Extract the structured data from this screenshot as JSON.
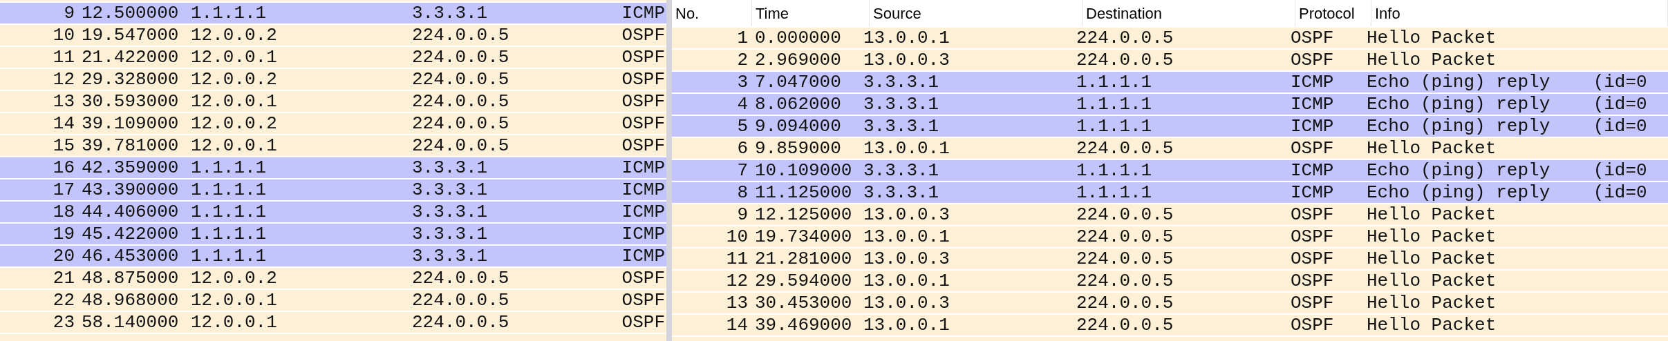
{
  "left_packet_list": {
    "rows": [
      {
        "no": "9",
        "time": "12.500000",
        "source": "1.1.1.1",
        "destination": "3.3.3.1",
        "protocol": "ICMP",
        "color": "#c4c4fc"
      },
      {
        "no": "10",
        "time": "19.547000",
        "source": "12.0.0.2",
        "destination": "224.0.0.5",
        "protocol": "OSPF",
        "color": "#fdf0d6"
      },
      {
        "no": "11",
        "time": "21.422000",
        "source": "12.0.0.1",
        "destination": "224.0.0.5",
        "protocol": "OSPF",
        "color": "#fdf0d6"
      },
      {
        "no": "12",
        "time": "29.328000",
        "source": "12.0.0.2",
        "destination": "224.0.0.5",
        "protocol": "OSPF",
        "color": "#fdf0d6"
      },
      {
        "no": "13",
        "time": "30.593000",
        "source": "12.0.0.1",
        "destination": "224.0.0.5",
        "protocol": "OSPF",
        "color": "#fdf0d6"
      },
      {
        "no": "14",
        "time": "39.109000",
        "source": "12.0.0.2",
        "destination": "224.0.0.5",
        "protocol": "OSPF",
        "color": "#fdf0d6"
      },
      {
        "no": "15",
        "time": "39.781000",
        "source": "12.0.0.1",
        "destination": "224.0.0.5",
        "protocol": "OSPF",
        "color": "#fdf0d6"
      },
      {
        "no": "16",
        "time": "42.359000",
        "source": "1.1.1.1",
        "destination": "3.3.3.1",
        "protocol": "ICMP",
        "color": "#c4c4fc"
      },
      {
        "no": "17",
        "time": "43.390000",
        "source": "1.1.1.1",
        "destination": "3.3.3.1",
        "protocol": "ICMP",
        "color": "#c4c4fc"
      },
      {
        "no": "18",
        "time": "44.406000",
        "source": "1.1.1.1",
        "destination": "3.3.3.1",
        "protocol": "ICMP",
        "color": "#c4c4fc"
      },
      {
        "no": "19",
        "time": "45.422000",
        "source": "1.1.1.1",
        "destination": "3.3.3.1",
        "protocol": "ICMP",
        "color": "#c4c4fc"
      },
      {
        "no": "20",
        "time": "46.453000",
        "source": "1.1.1.1",
        "destination": "3.3.3.1",
        "protocol": "ICMP",
        "color": "#c4c4fc"
      },
      {
        "no": "21",
        "time": "48.875000",
        "source": "12.0.0.2",
        "destination": "224.0.0.5",
        "protocol": "OSPF",
        "color": "#fdf0d6"
      },
      {
        "no": "22",
        "time": "48.968000",
        "source": "12.0.0.1",
        "destination": "224.0.0.5",
        "protocol": "OSPF",
        "color": "#fdf0d6"
      },
      {
        "no": "23",
        "time": "58.140000",
        "source": "12.0.0.1",
        "destination": "224.0.0.5",
        "protocol": "OSPF",
        "color": "#fdf0d6"
      }
    ]
  },
  "right_packet_list": {
    "columns": [
      "No.",
      "Time",
      "Source",
      "Destination",
      "Protocol",
      "Info"
    ],
    "rows": [
      {
        "no": "1",
        "time": "0.000000",
        "source": "13.0.0.1",
        "destination": "224.0.0.5",
        "protocol": "OSPF",
        "info": "Hello Packet",
        "color": "#fdf0d6"
      },
      {
        "no": "2",
        "time": "2.969000",
        "source": "13.0.0.3",
        "destination": "224.0.0.5",
        "protocol": "OSPF",
        "info": "Hello Packet",
        "color": "#fdf0d6"
      },
      {
        "no": "3",
        "time": "7.047000",
        "source": "3.3.3.1",
        "destination": "1.1.1.1",
        "protocol": "ICMP",
        "info": "Echo (ping) reply    (id=0",
        "color": "#c4c4fc"
      },
      {
        "no": "4",
        "time": "8.062000",
        "source": "3.3.3.1",
        "destination": "1.1.1.1",
        "protocol": "ICMP",
        "info": "Echo (ping) reply    (id=0",
        "color": "#c4c4fc"
      },
      {
        "no": "5",
        "time": "9.094000",
        "source": "3.3.3.1",
        "destination": "1.1.1.1",
        "protocol": "ICMP",
        "info": "Echo (ping) reply    (id=0",
        "color": "#c4c4fc"
      },
      {
        "no": "6",
        "time": "9.859000",
        "source": "13.0.0.1",
        "destination": "224.0.0.5",
        "protocol": "OSPF",
        "info": "Hello Packet",
        "color": "#fdf0d6"
      },
      {
        "no": "7",
        "time": "10.109000",
        "source": "3.3.3.1",
        "destination": "1.1.1.1",
        "protocol": "ICMP",
        "info": "Echo (ping) reply    (id=0",
        "color": "#c4c4fc"
      },
      {
        "no": "8",
        "time": "11.125000",
        "source": "3.3.3.1",
        "destination": "1.1.1.1",
        "protocol": "ICMP",
        "info": "Echo (ping) reply    (id=0",
        "color": "#c4c4fc"
      },
      {
        "no": "9",
        "time": "12.125000",
        "source": "13.0.0.3",
        "destination": "224.0.0.5",
        "protocol": "OSPF",
        "info": "Hello Packet",
        "color": "#fdf0d6"
      },
      {
        "no": "10",
        "time": "19.734000",
        "source": "13.0.0.1",
        "destination": "224.0.0.5",
        "protocol": "OSPF",
        "info": "Hello Packet",
        "color": "#fdf0d6"
      },
      {
        "no": "11",
        "time": "21.281000",
        "source": "13.0.0.3",
        "destination": "224.0.0.5",
        "protocol": "OSPF",
        "info": "Hello Packet",
        "color": "#fdf0d6"
      },
      {
        "no": "12",
        "time": "29.594000",
        "source": "13.0.0.1",
        "destination": "224.0.0.5",
        "protocol": "OSPF",
        "info": "Hello Packet",
        "color": "#fdf0d6"
      },
      {
        "no": "13",
        "time": "30.453000",
        "source": "13.0.0.3",
        "destination": "224.0.0.5",
        "protocol": "OSPF",
        "info": "Hello Packet",
        "color": "#fdf0d6"
      },
      {
        "no": "14",
        "time": "39.469000",
        "source": "13.0.0.1",
        "destination": "224.0.0.5",
        "protocol": "OSPF",
        "info": "Hello Packet",
        "color": "#fdf0d6"
      }
    ]
  }
}
